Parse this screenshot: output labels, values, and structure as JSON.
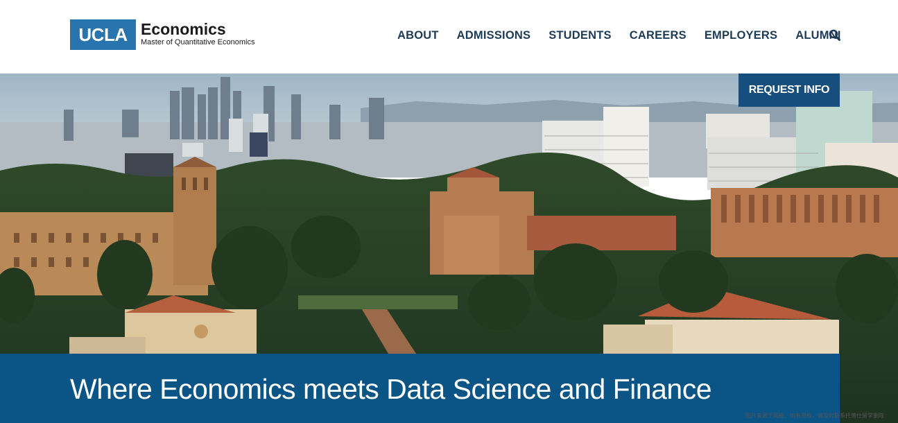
{
  "header": {
    "logo_box": "UCLA",
    "logo_title": "Economics",
    "logo_subtitle": "Master of Quantitative Economics"
  },
  "nav": {
    "items": [
      "ABOUT",
      "ADMISSIONS",
      "STUDENTS",
      "CAREERS",
      "EMPLOYERS",
      "ALUMNI"
    ],
    "search_icon": "search-icon"
  },
  "hero": {
    "request_button": "REQUEST INFO",
    "headline": "Where Economics meets Data Science and Finance",
    "watermark": "图片来源于网络，如有侵权，请及时联系托普仕留学删除"
  },
  "colors": {
    "ucla_blue": "#2774ae",
    "nav_text": "#1d3b57",
    "banner": "#0b5486",
    "button": "#164f7e"
  }
}
